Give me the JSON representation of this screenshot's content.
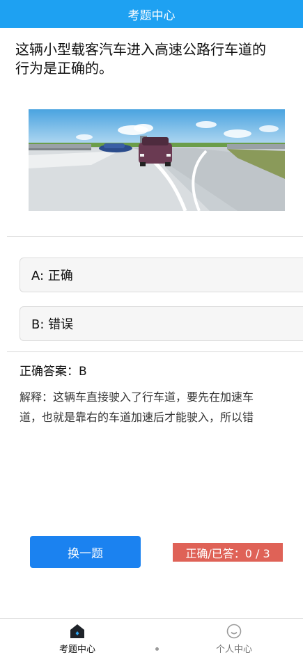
{
  "header": {
    "title": "考题中心"
  },
  "question": {
    "line1": "这辆小型载客汽车进入高速公路行车道的",
    "line2": "行为是正确的。"
  },
  "options": [
    {
      "label": "A: 正确"
    },
    {
      "label": "B: 错误"
    }
  ],
  "answer": {
    "text": "正确答案：B"
  },
  "explanation": {
    "line1": "解释：这辆车直接驶入了行车道，要先在加速车",
    "line2": "道，也就是靠右的车道加速后才能驶入，所以错"
  },
  "actions": {
    "next_label": "换一题",
    "score_label": "正确/已答：0 / 3"
  },
  "tabbar": {
    "items": [
      {
        "label": "考题中心",
        "icon": "home-icon",
        "active": true
      },
      {
        "label": "个人中心",
        "icon": "smile-icon",
        "active": false
      }
    ]
  },
  "colors": {
    "header": "#1ea1f2",
    "primary_button": "#1b82f0",
    "score_badge": "#df6257"
  }
}
